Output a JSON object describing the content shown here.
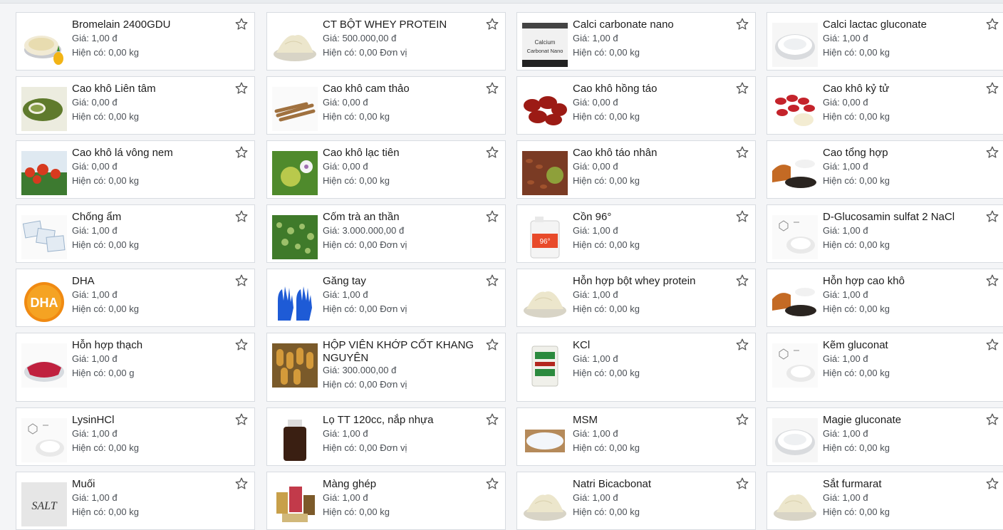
{
  "products": [
    {
      "name": "Bromelain 2400GDU",
      "price": "Giá: 1,00 đ",
      "stock": "Hiện có: 0,00 kg",
      "thumb": "powder-pineapple"
    },
    {
      "name": "CT BỘT WHEY PROTEIN",
      "price": "Giá: 500.000,00 đ",
      "stock": "Hiện có: 0,00 Đơn vị",
      "thumb": "powder"
    },
    {
      "name": "Calci carbonate nano",
      "price": "Giá: 1,00 đ",
      "stock": "Hiện có: 0,00 kg",
      "thumb": "label-calcium",
      "thumb_text": "Calcium Carbonat Nano"
    },
    {
      "name": "Calci lactac gluconate",
      "price": "Giá: 1,00 đ",
      "stock": "Hiện có: 0,00 kg",
      "thumb": "white-bowl"
    },
    {
      "name": "Cao khô Liên tâm",
      "price": "Giá: 0,00 đ",
      "stock": "Hiện có: 0,00 kg",
      "thumb": "green-herb"
    },
    {
      "name": "Cao khô cam thảo",
      "price": "Giá: 0,00 đ",
      "stock": "Hiện có: 0,00 kg",
      "thumb": "root-sticks"
    },
    {
      "name": "Cao khô hồng táo",
      "price": "Giá: 0,00 đ",
      "stock": "Hiện có: 0,00 kg",
      "thumb": "red-dates"
    },
    {
      "name": "Cao khô kỷ tử",
      "price": "Giá: 0,00 đ",
      "stock": "Hiện có: 0,00 kg",
      "thumb": "goji"
    },
    {
      "name": "Cao khô lá vông nem",
      "price": "Giá: 0,00 đ",
      "stock": "Hiện có: 0,00 kg",
      "thumb": "red-flowers"
    },
    {
      "name": "Cao khô lạc tiên",
      "price": "Giá: 0,00 đ",
      "stock": "Hiện có: 0,00 kg",
      "thumb": "green-fruit"
    },
    {
      "name": "Cao khô táo nhân",
      "price": "Giá: 0,00 đ",
      "stock": "Hiện có: 0,00 kg",
      "thumb": "seeds"
    },
    {
      "name": "Cao tổng hợp",
      "price": "Giá: 1,00 đ",
      "stock": "Hiện có: 0,00 kg",
      "thumb": "dark-powder"
    },
    {
      "name": "Chống ẩm",
      "price": "Giá: 1,00 đ",
      "stock": "Hiện có: 0,00 kg",
      "thumb": "packets"
    },
    {
      "name": "Cốm trà an thần",
      "price": "Giá: 3.000.000,00 đ",
      "stock": "Hiện có: 0,00 Đơn vị",
      "thumb": "green-granules"
    },
    {
      "name": "Cồn 96°",
      "price": "Giá: 1,00 đ",
      "stock": "Hiện có: 0,00 kg",
      "thumb": "jerrycan",
      "thumb_text": "96°"
    },
    {
      "name": "D-Glucosamin sulfat 2 NaCl",
      "price": "Giá: 1,00 đ",
      "stock": "Hiện có: 0,00 kg",
      "thumb": "chem-white"
    },
    {
      "name": "DHA",
      "price": "Giá: 1,00 đ",
      "stock": "Hiện có: 0,00 kg",
      "thumb": "dha-capsule",
      "thumb_text": "DHA"
    },
    {
      "name": "Găng tay",
      "price": "Giá: 1,00 đ",
      "stock": "Hiện có: 0,00 Đơn vị",
      "thumb": "gloves"
    },
    {
      "name": "Hỗn hợp bột whey protein",
      "price": "Giá: 1,00 đ",
      "stock": "Hiện có: 0,00 kg",
      "thumb": "powder"
    },
    {
      "name": "Hỗn hợp cao khô",
      "price": "Giá: 1,00 đ",
      "stock": "Hiện có: 0,00 kg",
      "thumb": "dark-powder"
    },
    {
      "name": "Hỗn hợp thạch",
      "price": "Giá: 1,00 đ",
      "stock": "Hiện có: 0,00 g",
      "thumb": "jelly"
    },
    {
      "name": "HỘP VIÊN KHỚP CỐT KHANG NGUYÊN",
      "price": "Giá: 300.000,00 đ",
      "stock": "Hiện có: 0,00 Đơn vị",
      "thumb": "capsules"
    },
    {
      "name": "KCl",
      "price": "Giá: 1,00 đ",
      "stock": "Hiện có: 0,00 kg",
      "thumb": "sack"
    },
    {
      "name": "Kẽm gluconat",
      "price": "Giá: 1,00 đ",
      "stock": "Hiện có: 0,00 kg",
      "thumb": "chem-white"
    },
    {
      "name": "LysinHCl",
      "price": "Giá: 1,00 đ",
      "stock": "Hiện có: 0,00 kg",
      "thumb": "chem-white"
    },
    {
      "name": "Lọ TT 120cc, nắp nhựa",
      "price": "Giá: 1,00 đ",
      "stock": "Hiện có: 0,00 Đơn vị",
      "thumb": "bottle"
    },
    {
      "name": "MSM",
      "price": "Giá: 1,00 đ",
      "stock": "Hiện có: 0,00 kg",
      "thumb": "crystals"
    },
    {
      "name": "Magie gluconate",
      "price": "Giá: 1,00 đ",
      "stock": "Hiện có: 0,00 kg",
      "thumb": "white-bowl"
    },
    {
      "name": "Muối",
      "price": "Giá: 1,00 đ",
      "stock": "Hiện có: 0,00 kg",
      "thumb": "salt",
      "thumb_text": "SALT"
    },
    {
      "name": "Màng ghép",
      "price": "Giá: 1,00 đ",
      "stock": "Hiện có: 0,00 kg",
      "thumb": "cans"
    },
    {
      "name": "Natri Bicacbonat",
      "price": "Giá: 1,00 đ",
      "stock": "Hiện có: 0,00 kg",
      "thumb": "powder"
    },
    {
      "name": "Sắt furmarat",
      "price": "Giá: 1,00 đ",
      "stock": "Hiện có: 0,00 kg",
      "thumb": "powder"
    }
  ]
}
